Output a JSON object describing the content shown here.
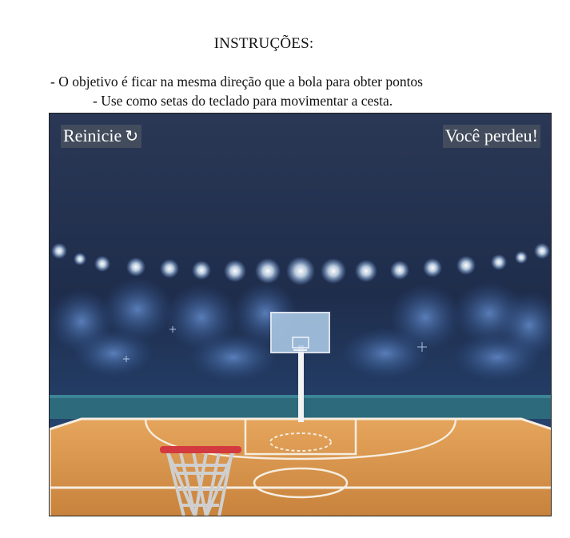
{
  "instructions": {
    "title": "INSTRUÇÕES:",
    "line1": "- O objetivo é ficar na mesma direção que a bola para obter pontos",
    "line2": "- Use como setas do teclado para movimentar a cesta."
  },
  "game": {
    "restart_label": "Reinicie",
    "restart_icon": "↻",
    "status": "Você perdeu!"
  },
  "colors": {
    "sky_top": "#263552",
    "crowd": "#2a4a7a",
    "court": "#d9944a",
    "rim": "#d33a3f",
    "net": "#cfcfcf"
  }
}
